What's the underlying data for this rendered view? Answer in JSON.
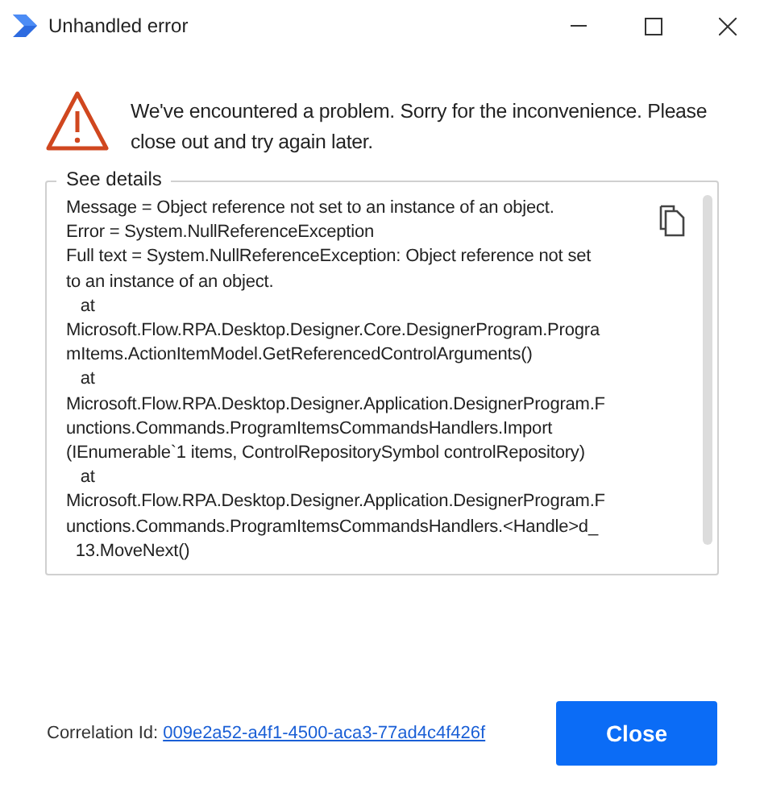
{
  "window": {
    "title": "Unhandled error"
  },
  "message": "We've encountered a problem. Sorry for the inconvenience. Please close out and try again later.",
  "details": {
    "legend": "See details",
    "lines": [
      "Message = Object reference not set to an instance of an object.",
      "Error = System.NullReferenceException",
      "Full text = System.NullReferenceException: Object reference not set",
      "to an instance of an object.",
      "   at",
      "Microsoft.Flow.RPA.Desktop.Designer.Core.DesignerProgram.Progra",
      "mItems.ActionItemModel.GetReferencedControlArguments()",
      "   at",
      "Microsoft.Flow.RPA.Desktop.Designer.Application.DesignerProgram.F",
      "unctions.Commands.ProgramItemsCommandsHandlers.Import",
      "(IEnumerable`1 items, ControlRepositorySymbol controlRepository)",
      "   at",
      "Microsoft.Flow.RPA.Desktop.Designer.Application.DesignerProgram.F",
      "unctions.Commands.ProgramItemsCommandsHandlers.<Handle>d_",
      "  13.MoveNext()"
    ]
  },
  "footer": {
    "correlation_label": "Correlation Id:",
    "correlation_id": "009e2a52-a4f1-4500-aca3-77ad4c4f426f",
    "button": "Close"
  }
}
